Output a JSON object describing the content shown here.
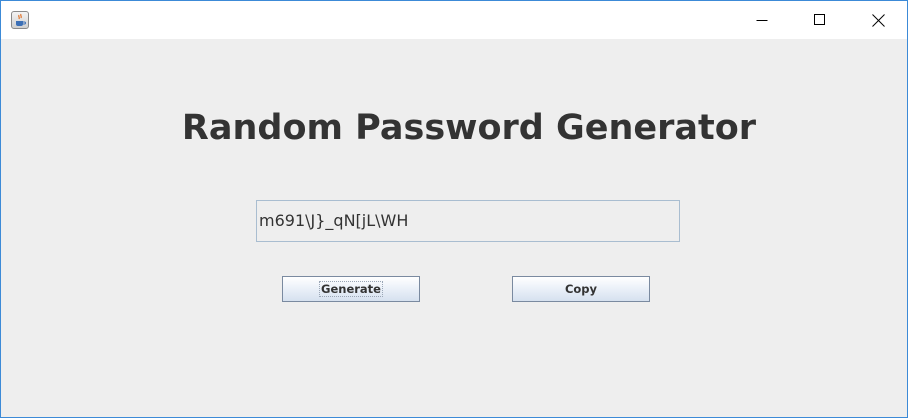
{
  "window": {
    "icon": "java-coffee-icon",
    "controls": {
      "minimize": "minimize-icon",
      "maximize": "maximize-icon",
      "close": "close-icon"
    }
  },
  "main": {
    "title": "Random Password Generator",
    "password_value": "m691\\J}_qN[jL\\WH",
    "generate_label": "Generate",
    "copy_label": "Copy"
  },
  "colors": {
    "background": "#eeeeee",
    "title_text": "#333333",
    "window_border": "#3c8ad7"
  }
}
